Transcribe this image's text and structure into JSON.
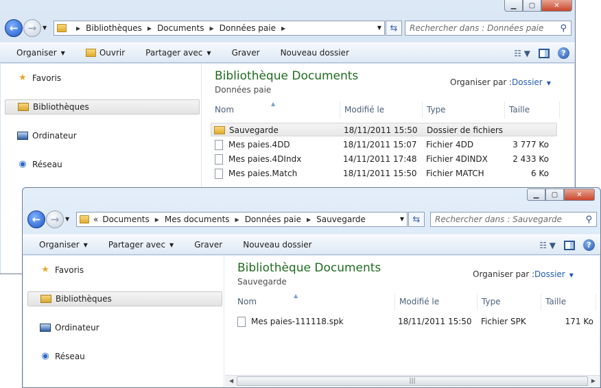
{
  "window1": {
    "breadcrumbs": [
      "Bibliothèques",
      "Documents",
      "Données paie"
    ],
    "search_placeholder": "Rechercher dans : Données paie",
    "toolbar": {
      "organize": "Organiser",
      "open": "Ouvrir",
      "share": "Partager avec",
      "burn": "Graver",
      "new_folder": "Nouveau dossier"
    },
    "nav": {
      "favorites": "Favoris",
      "libraries": "Bibliothèques",
      "computer": "Ordinateur",
      "network": "Réseau"
    },
    "library_title": "Bibliothèque Documents",
    "library_subtitle": "Données paie",
    "organize_by_label": "Organiser par :",
    "organize_by_value": "Dossier",
    "columns": {
      "name": "Nom",
      "modified": "Modifié le",
      "type": "Type",
      "size": "Taille"
    },
    "files": [
      {
        "name": "Sauvegarde",
        "modified": "18/11/2011 15:50",
        "type": "Dossier de fichiers",
        "size": ""
      },
      {
        "name": "Mes paies.4DD",
        "modified": "18/11/2011 15:07",
        "type": "Fichier 4DD",
        "size": "3 777 Ko"
      },
      {
        "name": "Mes paies.4DIndx",
        "modified": "14/11/2011 17:48",
        "type": "Fichier 4DINDX",
        "size": "2 433 Ko"
      },
      {
        "name": "Mes paies.Match",
        "modified": "18/11/2011 15:50",
        "type": "Fichier MATCH",
        "size": "6 Ko"
      }
    ]
  },
  "window2": {
    "overflow": "«",
    "breadcrumbs": [
      "Documents",
      "Mes documents",
      "Données paie",
      "Sauvegarde"
    ],
    "search_placeholder": "Rechercher dans : Sauvegarde",
    "toolbar": {
      "organize": "Organiser",
      "share": "Partager avec",
      "burn": "Graver",
      "new_folder": "Nouveau dossier"
    },
    "nav": {
      "favorites": "Favoris",
      "libraries": "Bibliothèques",
      "computer": "Ordinateur",
      "network": "Réseau"
    },
    "library_title": "Bibliothèque Documents",
    "library_subtitle": "Sauvegarde",
    "organize_by_label": "Organiser par :",
    "organize_by_value": "Dossier",
    "columns": {
      "name": "Nom",
      "modified": "Modifié le",
      "type": "Type",
      "size": "Taille"
    },
    "files": [
      {
        "name": "Mes paies-111118.spk",
        "modified": "18/11/2011 15:50",
        "type": "Fichier SPK",
        "size": "171 Ko"
      }
    ]
  },
  "icons": {
    "back": "back-arrow-icon",
    "forward": "forward-arrow-icon",
    "refresh": "refresh-icon",
    "search": "search-icon",
    "help": "help-icon"
  }
}
